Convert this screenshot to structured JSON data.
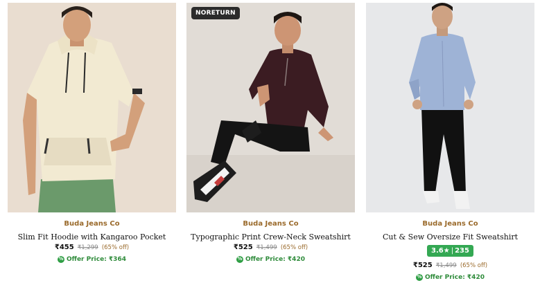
{
  "products": [
    {
      "brand": "Buda Jeans Co",
      "title": "Slim Fit Hoodie with Kangaroo Pocket",
      "price": "₹455",
      "mrp": "₹1,299",
      "discount": "(65% off)",
      "offer": "Offer Price: ₹364",
      "badge": "",
      "image_icon": "product-photo-hoodie"
    },
    {
      "brand": "Buda Jeans Co",
      "title": "Typographic Print Crew-Neck Sweatshirt",
      "price": "₹525",
      "mrp": "₹1,499",
      "discount": "(65% off)",
      "offer": "Offer Price: ₹420",
      "badge": "NORETURN",
      "image_icon": "product-photo-maroon-sweatshirt"
    },
    {
      "brand": "Buda Jeans Co",
      "title": "Cut & Sew Oversize Fit Sweatshirt",
      "rating": "3.6★",
      "rating_count": "235",
      "price": "₹525",
      "mrp": "₹1,499",
      "discount": "(65% off)",
      "offer": "Offer Price: ₹420",
      "badge": "",
      "image_icon": "product-photo-blue-sweatshirt"
    }
  ],
  "colors": {
    "brand_text": "#9a6a2b",
    "offer_green": "#2e8b3a",
    "rating_green": "#34a853",
    "badge_bg": "#2b2b2b"
  }
}
